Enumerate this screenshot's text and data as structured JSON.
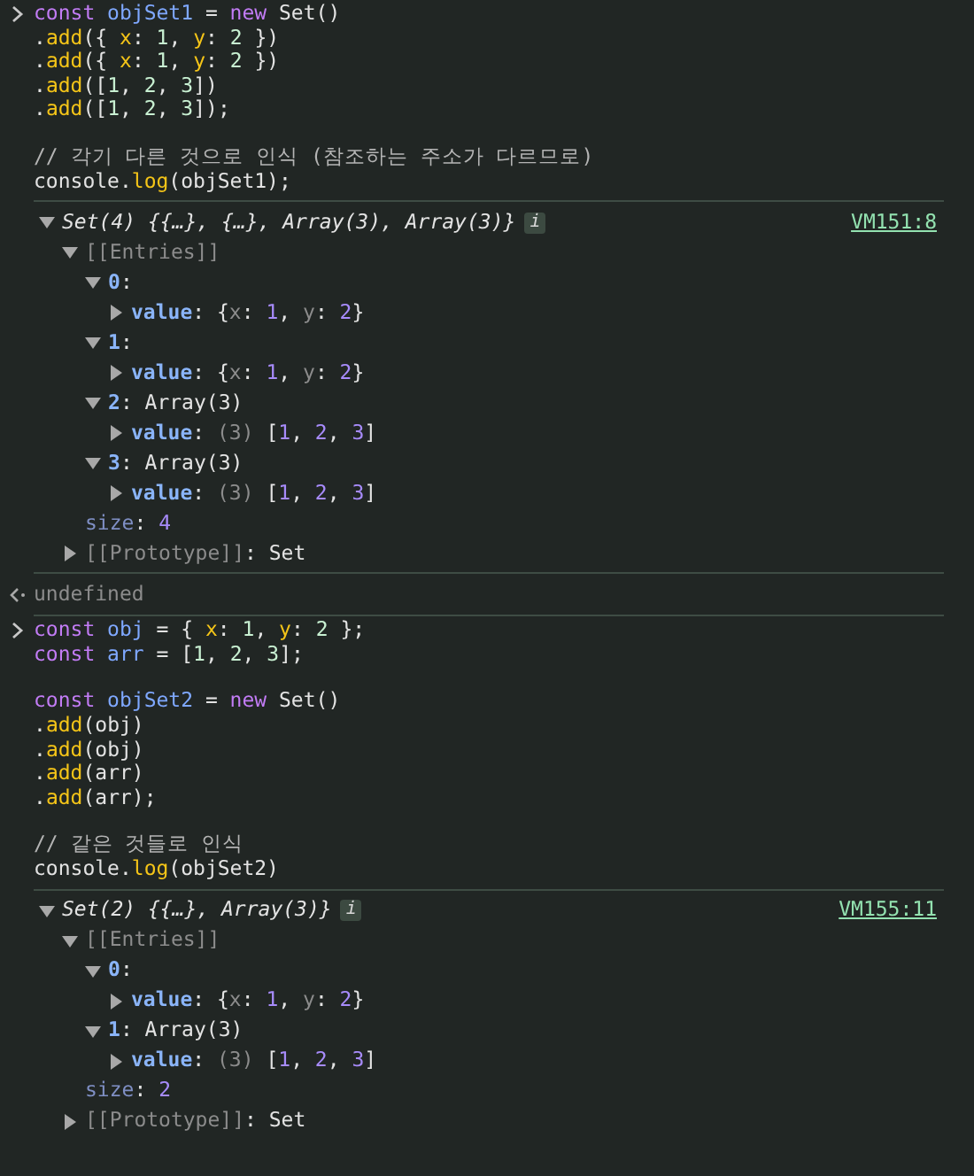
{
  "entries": [
    {
      "kind": "input",
      "blocks": [
        [
          [
            {
              "kind": "keyword",
              "text": "const "
            },
            {
              "kind": "variable",
              "text": "objSet1"
            },
            {
              "kind": "plain",
              "text": " = "
            },
            {
              "kind": "keyword",
              "text": "new"
            },
            {
              "kind": "plain",
              "text": " Set()"
            }
          ],
          [
            {
              "kind": "plain",
              "text": "."
            },
            {
              "kind": "method",
              "text": "add"
            },
            {
              "kind": "plain",
              "text": "({ "
            },
            {
              "kind": "property",
              "text": "x"
            },
            {
              "kind": "plain",
              "text": ": "
            },
            {
              "kind": "number",
              "text": "1"
            },
            {
              "kind": "plain",
              "text": ", "
            },
            {
              "kind": "property",
              "text": "y"
            },
            {
              "kind": "plain",
              "text": ": "
            },
            {
              "kind": "number",
              "text": "2"
            },
            {
              "kind": "plain",
              "text": " })"
            }
          ],
          [
            {
              "kind": "plain",
              "text": "."
            },
            {
              "kind": "method",
              "text": "add"
            },
            {
              "kind": "plain",
              "text": "({ "
            },
            {
              "kind": "property",
              "text": "x"
            },
            {
              "kind": "plain",
              "text": ": "
            },
            {
              "kind": "number",
              "text": "1"
            },
            {
              "kind": "plain",
              "text": ", "
            },
            {
              "kind": "property",
              "text": "y"
            },
            {
              "kind": "plain",
              "text": ": "
            },
            {
              "kind": "number",
              "text": "2"
            },
            {
              "kind": "plain",
              "text": " })"
            }
          ],
          [
            {
              "kind": "plain",
              "text": "."
            },
            {
              "kind": "method",
              "text": "add"
            },
            {
              "kind": "plain",
              "text": "(["
            },
            {
              "kind": "number",
              "text": "1"
            },
            {
              "kind": "plain",
              "text": ", "
            },
            {
              "kind": "number",
              "text": "2"
            },
            {
              "kind": "plain",
              "text": ", "
            },
            {
              "kind": "number",
              "text": "3"
            },
            {
              "kind": "plain",
              "text": "])"
            }
          ],
          [
            {
              "kind": "plain",
              "text": "."
            },
            {
              "kind": "method",
              "text": "add"
            },
            {
              "kind": "plain",
              "text": "(["
            },
            {
              "kind": "number",
              "text": "1"
            },
            {
              "kind": "plain",
              "text": ", "
            },
            {
              "kind": "number",
              "text": "2"
            },
            {
              "kind": "plain",
              "text": ", "
            },
            {
              "kind": "number",
              "text": "3"
            },
            {
              "kind": "plain",
              "text": "]);"
            }
          ]
        ],
        [
          [
            {
              "kind": "comment",
              "text": "// 각기 다른 것으로 인식 (참조하는 주소가 다르므로)"
            }
          ],
          [
            {
              "kind": "plain",
              "text": "console."
            },
            {
              "kind": "method",
              "text": "log"
            },
            {
              "kind": "plain",
              "text": "(objSet1);"
            }
          ]
        ]
      ]
    },
    {
      "kind": "log",
      "summary": "Set(4) {{…}, {…}, Array(3), Array(3)}",
      "badge": "i",
      "source": "VM151:8",
      "expanded": true,
      "children": [
        {
          "tokens": [
            {
              "kind": "internal",
              "text": "[[Entries]]"
            }
          ],
          "expanded": true,
          "children": [
            {
              "tokens": [
                {
                  "kind": "key",
                  "text": "0"
                },
                {
                  "kind": "plain",
                  "text": ":"
                }
              ],
              "expanded": true,
              "children": [
                {
                  "tokens": [
                    {
                      "kind": "key",
                      "text": "value"
                    },
                    {
                      "kind": "plain",
                      "text": ": {"
                    },
                    {
                      "kind": "dim",
                      "text": "x"
                    },
                    {
                      "kind": "plain",
                      "text": ": "
                    },
                    {
                      "kind": "value",
                      "text": "1"
                    },
                    {
                      "kind": "plain",
                      "text": ", "
                    },
                    {
                      "kind": "dim",
                      "text": "y"
                    },
                    {
                      "kind": "plain",
                      "text": ": "
                    },
                    {
                      "kind": "value",
                      "text": "2"
                    },
                    {
                      "kind": "plain",
                      "text": "}"
                    }
                  ],
                  "expanded": false
                }
              ]
            },
            {
              "tokens": [
                {
                  "kind": "key",
                  "text": "1"
                },
                {
                  "kind": "plain",
                  "text": ":"
                }
              ],
              "expanded": true,
              "children": [
                {
                  "tokens": [
                    {
                      "kind": "key",
                      "text": "value"
                    },
                    {
                      "kind": "plain",
                      "text": ": {"
                    },
                    {
                      "kind": "dim",
                      "text": "x"
                    },
                    {
                      "kind": "plain",
                      "text": ": "
                    },
                    {
                      "kind": "value",
                      "text": "1"
                    },
                    {
                      "kind": "plain",
                      "text": ", "
                    },
                    {
                      "kind": "dim",
                      "text": "y"
                    },
                    {
                      "kind": "plain",
                      "text": ": "
                    },
                    {
                      "kind": "value",
                      "text": "2"
                    },
                    {
                      "kind": "plain",
                      "text": "}"
                    }
                  ],
                  "expanded": false
                }
              ]
            },
            {
              "tokens": [
                {
                  "kind": "key",
                  "text": "2"
                },
                {
                  "kind": "plain",
                  "text": ": Array(3)"
                }
              ],
              "expanded": true,
              "children": [
                {
                  "tokens": [
                    {
                      "kind": "key",
                      "text": "value"
                    },
                    {
                      "kind": "plain",
                      "text": ": "
                    },
                    {
                      "kind": "dim",
                      "text": "(3)"
                    },
                    {
                      "kind": "plain",
                      "text": " ["
                    },
                    {
                      "kind": "value",
                      "text": "1"
                    },
                    {
                      "kind": "plain",
                      "text": ", "
                    },
                    {
                      "kind": "value",
                      "text": "2"
                    },
                    {
                      "kind": "plain",
                      "text": ", "
                    },
                    {
                      "kind": "value",
                      "text": "3"
                    },
                    {
                      "kind": "plain",
                      "text": "]"
                    }
                  ],
                  "expanded": false
                }
              ]
            },
            {
              "tokens": [
                {
                  "kind": "key",
                  "text": "3"
                },
                {
                  "kind": "plain",
                  "text": ": Array(3)"
                }
              ],
              "expanded": true,
              "children": [
                {
                  "tokens": [
                    {
                      "kind": "key",
                      "text": "value"
                    },
                    {
                      "kind": "plain",
                      "text": ": "
                    },
                    {
                      "kind": "dim",
                      "text": "(3)"
                    },
                    {
                      "kind": "plain",
                      "text": " ["
                    },
                    {
                      "kind": "value",
                      "text": "1"
                    },
                    {
                      "kind": "plain",
                      "text": ", "
                    },
                    {
                      "kind": "value",
                      "text": "2"
                    },
                    {
                      "kind": "plain",
                      "text": ", "
                    },
                    {
                      "kind": "value",
                      "text": "3"
                    },
                    {
                      "kind": "plain",
                      "text": "]"
                    }
                  ],
                  "expanded": false
                }
              ]
            }
          ]
        },
        {
          "tokens": [
            {
              "kind": "meta",
              "text": "size"
            },
            {
              "kind": "plain",
              "text": ": "
            },
            {
              "kind": "value",
              "text": "4"
            }
          ]
        },
        {
          "tokens": [
            {
              "kind": "internal",
              "text": "[[Prototype]]"
            },
            {
              "kind": "plain",
              "text": ": Set"
            }
          ],
          "expanded": false
        }
      ]
    },
    {
      "kind": "result",
      "text": "undefined"
    },
    {
      "kind": "input",
      "blocks": [
        [
          [
            {
              "kind": "keyword",
              "text": "const "
            },
            {
              "kind": "variable",
              "text": "obj"
            },
            {
              "kind": "plain",
              "text": " = { "
            },
            {
              "kind": "property",
              "text": "x"
            },
            {
              "kind": "plain",
              "text": ": "
            },
            {
              "kind": "number",
              "text": "1"
            },
            {
              "kind": "plain",
              "text": ", "
            },
            {
              "kind": "property",
              "text": "y"
            },
            {
              "kind": "plain",
              "text": ": "
            },
            {
              "kind": "number",
              "text": "2"
            },
            {
              "kind": "plain",
              "text": " };"
            }
          ],
          [
            {
              "kind": "keyword",
              "text": "const "
            },
            {
              "kind": "variable",
              "text": "arr"
            },
            {
              "kind": "plain",
              "text": " = ["
            },
            {
              "kind": "number",
              "text": "1"
            },
            {
              "kind": "plain",
              "text": ", "
            },
            {
              "kind": "number",
              "text": "2"
            },
            {
              "kind": "plain",
              "text": ", "
            },
            {
              "kind": "number",
              "text": "3"
            },
            {
              "kind": "plain",
              "text": "];"
            }
          ]
        ],
        [
          [
            {
              "kind": "keyword",
              "text": "const "
            },
            {
              "kind": "variable",
              "text": "objSet2"
            },
            {
              "kind": "plain",
              "text": " = "
            },
            {
              "kind": "keyword",
              "text": "new"
            },
            {
              "kind": "plain",
              "text": " Set()"
            }
          ],
          [
            {
              "kind": "plain",
              "text": "."
            },
            {
              "kind": "method",
              "text": "add"
            },
            {
              "kind": "plain",
              "text": "(obj)"
            }
          ],
          [
            {
              "kind": "plain",
              "text": "."
            },
            {
              "kind": "method",
              "text": "add"
            },
            {
              "kind": "plain",
              "text": "(obj)"
            }
          ],
          [
            {
              "kind": "plain",
              "text": "."
            },
            {
              "kind": "method",
              "text": "add"
            },
            {
              "kind": "plain",
              "text": "(arr)"
            }
          ],
          [
            {
              "kind": "plain",
              "text": "."
            },
            {
              "kind": "method",
              "text": "add"
            },
            {
              "kind": "plain",
              "text": "(arr);"
            }
          ]
        ],
        [
          [
            {
              "kind": "comment",
              "text": "// 같은 것들로 인식"
            }
          ],
          [
            {
              "kind": "plain",
              "text": "console."
            },
            {
              "kind": "method",
              "text": "log"
            },
            {
              "kind": "plain",
              "text": "(objSet2)"
            }
          ]
        ]
      ]
    },
    {
      "kind": "log",
      "summary": "Set(2) {{…}, Array(3)}",
      "badge": "i",
      "source": "VM155:11",
      "expanded": true,
      "children": [
        {
          "tokens": [
            {
              "kind": "internal",
              "text": "[[Entries]]"
            }
          ],
          "expanded": true,
          "children": [
            {
              "tokens": [
                {
                  "kind": "key",
                  "text": "0"
                },
                {
                  "kind": "plain",
                  "text": ":"
                }
              ],
              "expanded": true,
              "children": [
                {
                  "tokens": [
                    {
                      "kind": "key",
                      "text": "value"
                    },
                    {
                      "kind": "plain",
                      "text": ": {"
                    },
                    {
                      "kind": "dim",
                      "text": "x"
                    },
                    {
                      "kind": "plain",
                      "text": ": "
                    },
                    {
                      "kind": "value",
                      "text": "1"
                    },
                    {
                      "kind": "plain",
                      "text": ", "
                    },
                    {
                      "kind": "dim",
                      "text": "y"
                    },
                    {
                      "kind": "plain",
                      "text": ": "
                    },
                    {
                      "kind": "value",
                      "text": "2"
                    },
                    {
                      "kind": "plain",
                      "text": "}"
                    }
                  ],
                  "expanded": false
                }
              ]
            },
            {
              "tokens": [
                {
                  "kind": "key",
                  "text": "1"
                },
                {
                  "kind": "plain",
                  "text": ": Array(3)"
                }
              ],
              "expanded": true,
              "children": [
                {
                  "tokens": [
                    {
                      "kind": "key",
                      "text": "value"
                    },
                    {
                      "kind": "plain",
                      "text": ": "
                    },
                    {
                      "kind": "dim",
                      "text": "(3)"
                    },
                    {
                      "kind": "plain",
                      "text": " ["
                    },
                    {
                      "kind": "value",
                      "text": "1"
                    },
                    {
                      "kind": "plain",
                      "text": ", "
                    },
                    {
                      "kind": "value",
                      "text": "2"
                    },
                    {
                      "kind": "plain",
                      "text": ", "
                    },
                    {
                      "kind": "value",
                      "text": "3"
                    },
                    {
                      "kind": "plain",
                      "text": "]"
                    }
                  ],
                  "expanded": false
                }
              ]
            }
          ]
        },
        {
          "tokens": [
            {
              "kind": "meta",
              "text": "size"
            },
            {
              "kind": "plain",
              "text": ": "
            },
            {
              "kind": "value",
              "text": "2"
            }
          ]
        },
        {
          "tokens": [
            {
              "kind": "internal",
              "text": "[[Prototype]]"
            },
            {
              "kind": "plain",
              "text": ": Set"
            }
          ],
          "expanded": false
        }
      ]
    }
  ]
}
